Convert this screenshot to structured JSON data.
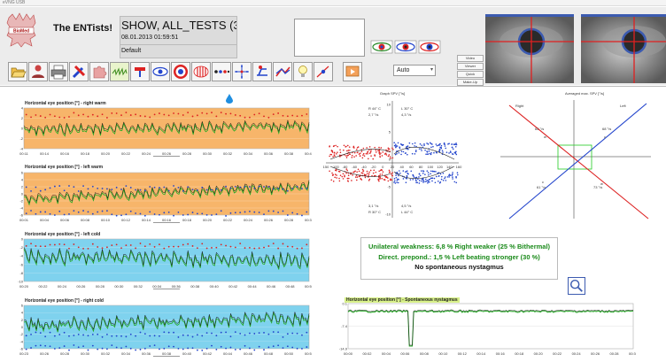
{
  "window": {
    "title": "eVNG USB"
  },
  "header": {
    "logo_text": "BioMed",
    "app_name": "The ENTists!",
    "session_title": "SHOW, ALL_TESTS (3",
    "session_date": "08.01.2013 01:59:51",
    "session_profile": "Default",
    "mode_select_value": "Auto",
    "side_buttons": [
      "Video",
      "Viewer",
      "Quick",
      "Make-Up"
    ]
  },
  "toolbar": {
    "icons": [
      "open-folder-icon",
      "patient-icon",
      "print-icon",
      "settings-tools-icon",
      "puzzle-icon",
      "caloric-wave-icon",
      "rotary-chair-icon",
      "eye-icon",
      "target-icon",
      "striped-drum-icon",
      "saccade-dots-icon",
      "fixation-cross-icon",
      "positional-chair-icon",
      "head-impulse-icon",
      "lightbulb-icon",
      "pursuit-icon",
      "playback-icon"
    ]
  },
  "panels": {
    "rw": {
      "title": "Horizontal eye position [°] - right warm",
      "bg": "#f7b56a",
      "y_ticks": [
        "4",
        "2",
        "0",
        "-2",
        "-4"
      ],
      "x_ticks": [
        "00:11",
        "00:14",
        "00:16",
        "00:18",
        "00:20",
        "00:22",
        "00:24",
        "00:26",
        "00:28",
        "00:30",
        "00:32",
        "00:34",
        "00:36",
        "00:38",
        "00:41"
      ]
    },
    "lw": {
      "title": "Horizontal eye position [°] - left warm",
      "bg": "#f7b56a",
      "y_ticks": [
        "6",
        "4",
        "2",
        "0",
        "-2",
        "-4",
        "-6"
      ],
      "x_ticks": [
        "00:01",
        "00:04",
        "00:06",
        "00:08",
        "00:10",
        "00:12",
        "00:14",
        "00:16",
        "00:18",
        "00:20",
        "00:22",
        "00:24",
        "00:26",
        "00:28",
        "00:31"
      ]
    },
    "lc": {
      "title": "Horizontal eye position [°] - left cold",
      "bg": "#7fd2ee",
      "y_ticks": [
        "0",
        "-2",
        "-4",
        "-6",
        "-8",
        "-10"
      ],
      "x_ticks": [
        "00:20",
        "00:22",
        "00:24",
        "00:26",
        "00:28",
        "00:30",
        "00:32",
        "00:34",
        "00:36",
        "00:38",
        "00:40",
        "00:42",
        "00:44",
        "00:46",
        "00:48",
        "00:50"
      ]
    },
    "rc": {
      "title": "Horizontal eye position [°] - right cold",
      "bg": "#7fd2ee",
      "y_ticks": [
        "6",
        "4",
        "2",
        "0",
        "-2",
        "-4",
        "-6"
      ],
      "x_ticks": [
        "00:23",
        "00:26",
        "00:28",
        "00:30",
        "00:32",
        "00:34",
        "00:36",
        "00:38",
        "00:40",
        "00:42",
        "00:44",
        "00:46",
        "00:48",
        "00:50",
        "00:53"
      ]
    },
    "sn": {
      "title": "Horizontal eye position [°] - Spontaneous nystagmus",
      "y_ticks": [
        "0.1",
        "-7.4",
        "-14.9"
      ],
      "x_ticks": [
        "00:00",
        "00:02",
        "00:04",
        "00:06",
        "00:08",
        "00:10",
        "00:12",
        "00:14",
        "00:16",
        "00:18",
        "00:20",
        "00:22",
        "00:24",
        "00:26",
        "00:28",
        "00:30"
      ]
    }
  },
  "spv_graph": {
    "title": "Graph SPV [°/s]",
    "r44": "R 44° C",
    "r44_pct": "2,7 °/s",
    "l30": "L 30° C",
    "l30_pct": "4,3 °/s",
    "r30_pct": "3,1 °/s",
    "r30": "R 30° C",
    "l44_pct": "4,5 °/s",
    "l44": "L 44° C",
    "y_ticks": [
      "10",
      "5",
      "0",
      "-5",
      "-10"
    ],
    "x_ticks": [
      "150",
      "-100",
      "-80",
      "-60",
      "-40",
      "-20",
      "0",
      "20",
      "40",
      "60",
      "80",
      "100",
      "120",
      "140",
      "160"
    ]
  },
  "avg_graph": {
    "title": "Averaged max. SPV [°/s]",
    "right": "Right",
    "left": "Left",
    "v1": "62 °/s",
    "v2": "68 °/s",
    "v3": "61 °/s",
    "v4": "73 °/s",
    "w1": "w",
    "w2": "w",
    "c1": "c",
    "c2": "c"
  },
  "results": {
    "line1": "Unilateral weakness:  6,8 % Right weaker (25 % Bithermal)",
    "line2": "Direct. prepond.:  1,5 % Left beating stronger (30 %)",
    "line3": "No spontaneous nystagmus"
  },
  "colors": {
    "red": "#dd2222",
    "blue": "#2244cc",
    "green": "#22aa22"
  }
}
